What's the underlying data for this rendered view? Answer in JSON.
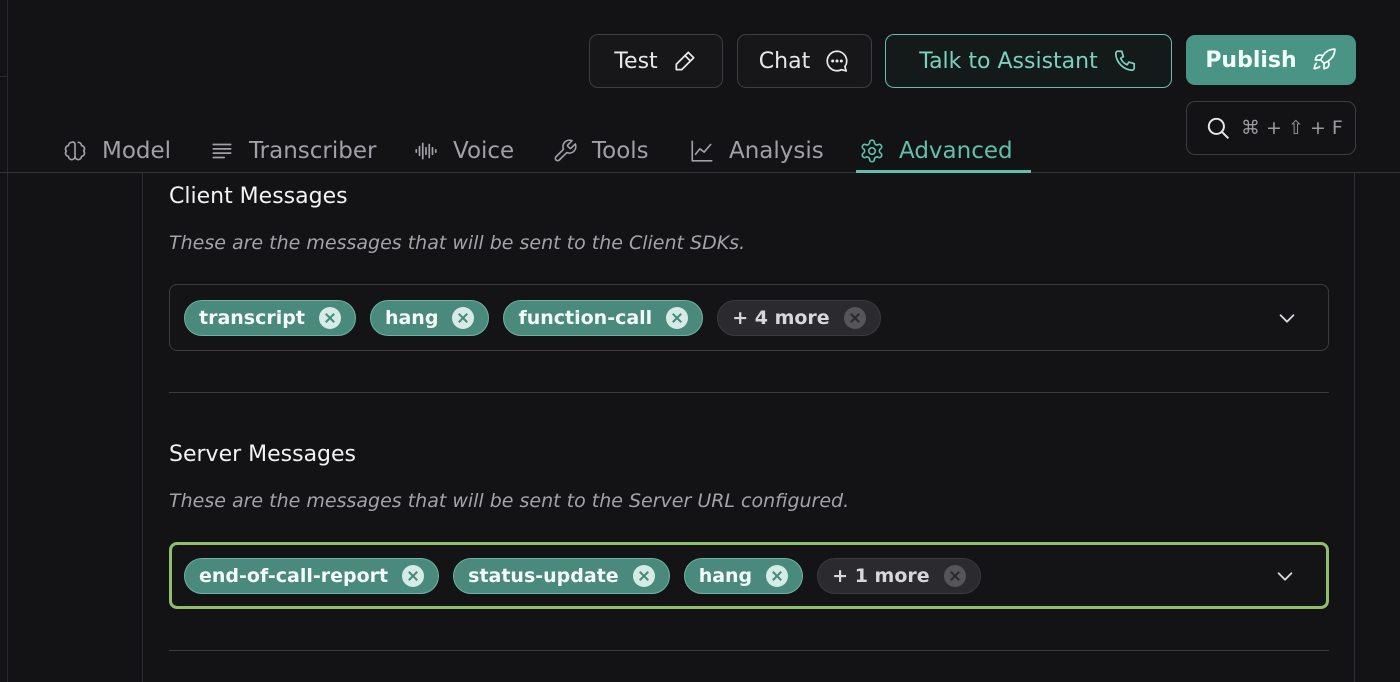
{
  "header": {
    "test_label": "Test",
    "chat_label": "Chat",
    "talk_label": "Talk to Assistant",
    "publish_label": "Publish",
    "search_shortcut": "⌘ + ⇧ + F"
  },
  "tabs": [
    {
      "label": "Model",
      "icon": "brain-icon"
    },
    {
      "label": "Transcriber",
      "icon": "text-lines-icon"
    },
    {
      "label": "Voice",
      "icon": "waveform-icon"
    },
    {
      "label": "Tools",
      "icon": "wrench-icon"
    },
    {
      "label": "Analysis",
      "icon": "chart-icon"
    },
    {
      "label": "Advanced",
      "icon": "gear-icon",
      "active": true
    }
  ],
  "client_messages": {
    "title": "Client Messages",
    "description": "These are the messages that will be sent to the Client SDKs.",
    "chips": [
      "transcript",
      "hang",
      "function-call"
    ],
    "more_label": "+ 4 more"
  },
  "server_messages": {
    "title": "Server Messages",
    "description": "These are the messages that will be sent to the Server URL configured.",
    "chips": [
      "end-of-call-report",
      "status-update",
      "hang"
    ],
    "more_label": "+ 1 more"
  },
  "colors": {
    "accent": "#5fc0ab",
    "publish_bg": "#4a9485",
    "focus_border": "#8fbf6a"
  }
}
